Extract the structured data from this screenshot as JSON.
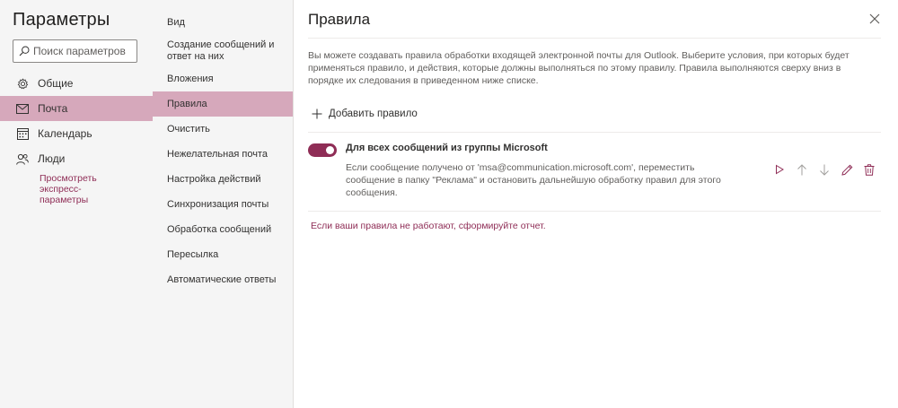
{
  "app": {
    "title": "Параметры",
    "search_placeholder": "Поиск параметров"
  },
  "categories": [
    {
      "label": "Общие",
      "icon": "gear-icon"
    },
    {
      "label": "Почта",
      "icon": "mail-icon",
      "active": true
    },
    {
      "label": "Календарь",
      "icon": "calendar-icon"
    },
    {
      "label": "Люди",
      "icon": "people-icon"
    }
  ],
  "express_link": "Просмотреть экспресс-параметры",
  "subnav": [
    "Вид",
    "Создание сообщений и ответ на них",
    "Вложения",
    "Правила",
    "Очистить",
    "Нежелательная почта",
    "Настройка действий",
    "Синхронизация почты",
    "Обработка сообщений",
    "Пересылка",
    "Автоматические ответы"
  ],
  "subnav_active_index": 3,
  "panel": {
    "title": "Правила",
    "description": "Вы можете создавать правила обработки входящей электронной почты для Outlook. Выберите условия, при которых будет применяться правило, и действия, которые должны выполняться по этому правилу. Правила выполняются сверху вниз в порядке их следования в приведенном ниже списке.",
    "add_rule_label": "Добавить правило",
    "rule": {
      "enabled": true,
      "name": "Для всех сообщений из группы Microsoft",
      "description": "Если сообщение получено от 'msa@communication.microsoft.com', переместить сообщение в папку \"Реклама\" и остановить дальнейшую обработку правил для этого сообщения.",
      "actions": [
        "run-icon",
        "move-up-icon",
        "move-down-icon",
        "edit-icon",
        "delete-icon"
      ]
    },
    "report_link": "Если ваши правила не работают, сформируйте отчет."
  },
  "colors": {
    "accent": "#8f2d56",
    "selected_bg": "#d6a8bb",
    "pane_bg": "#f5f5f5"
  }
}
